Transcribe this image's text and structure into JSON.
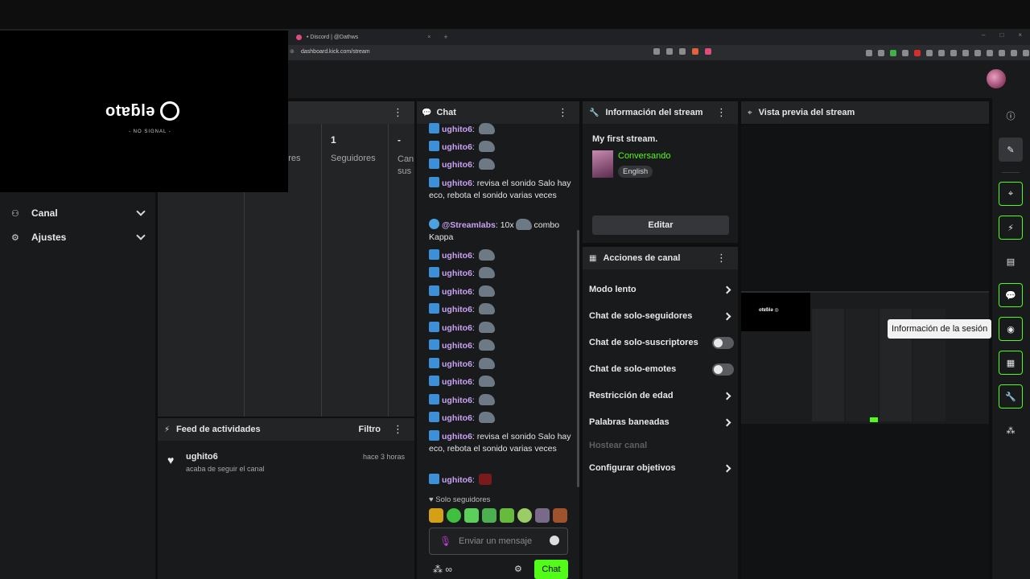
{
  "browser": {
    "tab_title": "• Discord | @Dathws",
    "tab_close": "×",
    "tab_new": "+",
    "url": "dashboard.kick.com/stream",
    "win_min": "–",
    "win_max": "□",
    "win_close": "×"
  },
  "elgato": {
    "logo_text": "otɐƃlǝ",
    "sub_text": "- NO SIGNAL -"
  },
  "sidebar": {
    "items": [
      {
        "label": "Canal",
        "icon": "users-gear-icon"
      },
      {
        "label": "Ajustes",
        "icon": "gear-icon"
      }
    ]
  },
  "stats": {
    "columns": [
      {
        "value": "",
        "label": "dores"
      },
      {
        "value": "1",
        "label": "Seguidores"
      },
      {
        "value": "-",
        "label": "Can sus"
      }
    ]
  },
  "feed": {
    "title": "Feed de actividades",
    "filter": "Filtro",
    "items": [
      {
        "user": "ughito6",
        "desc": "acaba de seguir el canal",
        "time": "hace 3 horas"
      }
    ]
  },
  "chat": {
    "title": "Chat",
    "messages": [
      {
        "user": "ughito6",
        "text": ""
      },
      {
        "user": "ughito6",
        "text": ""
      },
      {
        "user": "ughito6",
        "text": ""
      },
      {
        "user": "ughito6",
        "text": "revisa el sonido Salo hay eco, rebota el sonido varias veces"
      },
      {
        "user": "@Streamlabs",
        "text": "10x",
        "suffix": "combo Kappa"
      },
      {
        "user": "ughito6",
        "text": ""
      },
      {
        "user": "ughito6",
        "text": ""
      },
      {
        "user": "ughito6",
        "text": ""
      },
      {
        "user": "ughito6",
        "text": ""
      },
      {
        "user": "ughito6",
        "text": ""
      },
      {
        "user": "ughito6",
        "text": ""
      },
      {
        "user": "ughito6",
        "text": ""
      },
      {
        "user": "ughito6",
        "text": ""
      },
      {
        "user": "ughito6",
        "text": ""
      },
      {
        "user": "ughito6",
        "text": ""
      },
      {
        "user": "ughito6",
        "text": "revisa el sonido Salo hay eco, rebota el sonido varias veces"
      },
      {
        "user": "ughito6",
        "text": ""
      }
    ],
    "followers_only": "Solo seguidores",
    "input_placeholder": "Enviar un mensaje",
    "send_label": "Chat",
    "infinity": "∞"
  },
  "stream_info": {
    "header": "Información del stream",
    "title": "My first stream.",
    "category": "Conversando",
    "language": "English",
    "edit_label": "Editar"
  },
  "channel_actions": {
    "header": "Acciones de canal",
    "rows": [
      {
        "label": "Modo lento",
        "control": "chevron"
      },
      {
        "label": "Chat de solo-seguidores",
        "control": "chevron"
      },
      {
        "label": "Chat de solo-suscriptores",
        "control": "toggle"
      },
      {
        "label": "Chat de solo-emotes",
        "control": "toggle"
      },
      {
        "label": "Restricción de edad",
        "control": "chevron"
      },
      {
        "label": "Palabras baneadas",
        "control": "chevron"
      },
      {
        "label": "Hostear canal",
        "control": "none"
      },
      {
        "label": "Configurar objetivos",
        "control": "chevron"
      }
    ]
  },
  "preview": {
    "header": "Vista previa del stream",
    "mini_logo": "otɐƃlǝ ◎"
  },
  "right_rail": {
    "tooltip": "Información de la sesión"
  },
  "colors": {
    "accent_green": "#53fc18",
    "username_purple": "#c7a2f5",
    "panel_bg": "#191a1b"
  }
}
